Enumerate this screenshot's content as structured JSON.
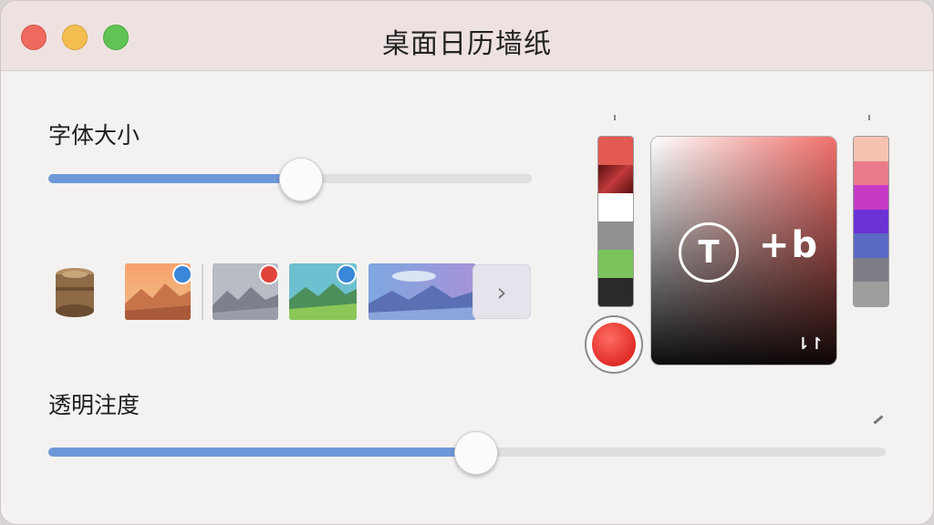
{
  "window": {
    "title": "桌面日历墙纸"
  },
  "font_size": {
    "label": "字体大小",
    "value_fraction": 0.52
  },
  "opacity": {
    "label": "透明注度",
    "value_fraction": 0.51
  },
  "wallpapers": {
    "items": [
      {
        "name": "sunset-landscape",
        "badge_color": "#3a86d9"
      },
      {
        "name": "gray-landscape",
        "badge_color": "#e0453a"
      },
      {
        "name": "green-landscape",
        "badge_color": "#3a86d9"
      },
      {
        "name": "blue-landscape",
        "badge_color": ""
      }
    ],
    "next_label": "›"
  },
  "picker": {
    "t_label": "T",
    "mode_label": "+b",
    "corner_icon": "⇂↾"
  },
  "left_swatches": [
    "#e25a50",
    "#8a1a1e",
    "#ffffff",
    "#909090",
    "#7cc55c",
    "#2a2a2a"
  ],
  "right_swatches": [
    "#f5c2b1",
    "#e87b8a",
    "#c53bc6",
    "#6b33d6",
    "#5a6ac5",
    "#7d7d85",
    "#9d9d9d"
  ],
  "colors": {
    "accent": "#6d98d8",
    "record": "#e8332c"
  }
}
